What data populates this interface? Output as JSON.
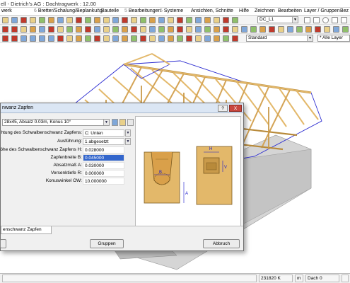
{
  "window": {
    "title": "ell - Dietrich's AG : Dachtragwerk : 12.00"
  },
  "menu": [
    {
      "num": "",
      "label": "werk"
    },
    {
      "num": "6",
      "label": "Bretter/Schalung/Beplankung"
    },
    {
      "num": "6",
      "label": "Bauteile"
    },
    {
      "num": "5",
      "label": "Bearbeitungen"
    },
    {
      "num": "5",
      "label": "Systeme"
    },
    {
      "num": "",
      "label": "Ansichten, Schnitte"
    },
    {
      "num": "",
      "label": "Hilfe"
    },
    {
      "num": "",
      "label": "Zeichnen"
    },
    {
      "num": "",
      "label": "Bearbeiten"
    },
    {
      "num": "",
      "label": "Layer / Gruppen"
    },
    {
      "num": "",
      "label": "Bez"
    }
  ],
  "toolbar": {
    "layer_select": "DC_L1",
    "style_select": "Standard",
    "layers_filter": "* Alle Layer"
  },
  "dialog": {
    "title": "nwanz Zapfen",
    "help_button": "?",
    "close_button": "X",
    "config_select": "28x45, Absatz 0.03m, Konus 10°",
    "params": [
      {
        "label": "htung des Schwalbenschwanz Zapfens:",
        "value": "C: Unten",
        "kind": "dropdown"
      },
      {
        "label": "Ausführung:",
        "value": "1  abgesetzt",
        "kind": "dropdown"
      },
      {
        "label": "öhe des Schwalbenschwanz Zapfens H:",
        "value": "0.028000",
        "kind": "text"
      },
      {
        "label": "Zapfenbreite B:",
        "value": "0.045000",
        "kind": "selected"
      },
      {
        "label": "Absatzmaß A:",
        "value": "0.030000",
        "kind": "text"
      },
      {
        "label": "Versenktiefe R:",
        "value": "0.000000",
        "kind": "text"
      },
      {
        "label": "Konuswinkel OW:",
        "value": "10.000000",
        "kind": "text"
      }
    ],
    "preview_labels": {
      "H": "H",
      "B": "B",
      "A": "A",
      "V": "V"
    },
    "tab_label": "enschwanz Zapfen",
    "buttons": {
      "groups": "Gruppen",
      "cancel": "Abbruch"
    }
  },
  "statusbar": {
    "coords": "231820 K",
    "unit": "m",
    "layer": "Dach 0"
  },
  "colors": {
    "wood": "#e3b86a",
    "wood_dark": "#b88a3a",
    "roof_blue": "#2222cc",
    "concrete": "#d5d5d5"
  }
}
